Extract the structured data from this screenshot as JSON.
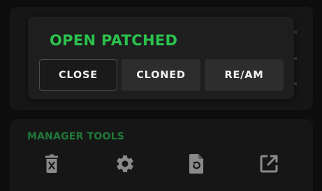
{
  "popup": {
    "title": "OPEN PATCHED",
    "buttons": [
      {
        "label": "CLOSE"
      },
      {
        "label": "CLONED"
      },
      {
        "label": "RE/AM"
      }
    ]
  },
  "manager_tools": {
    "title": "MANAGER TOOLS",
    "icons": [
      "delete-icon",
      "settings-gear-icon",
      "restore-file-icon",
      "open-external-icon"
    ]
  },
  "colors": {
    "title_green": "#2bc24d",
    "section_green": "#1f7a38",
    "icon_gray": "#8a8a8a"
  }
}
